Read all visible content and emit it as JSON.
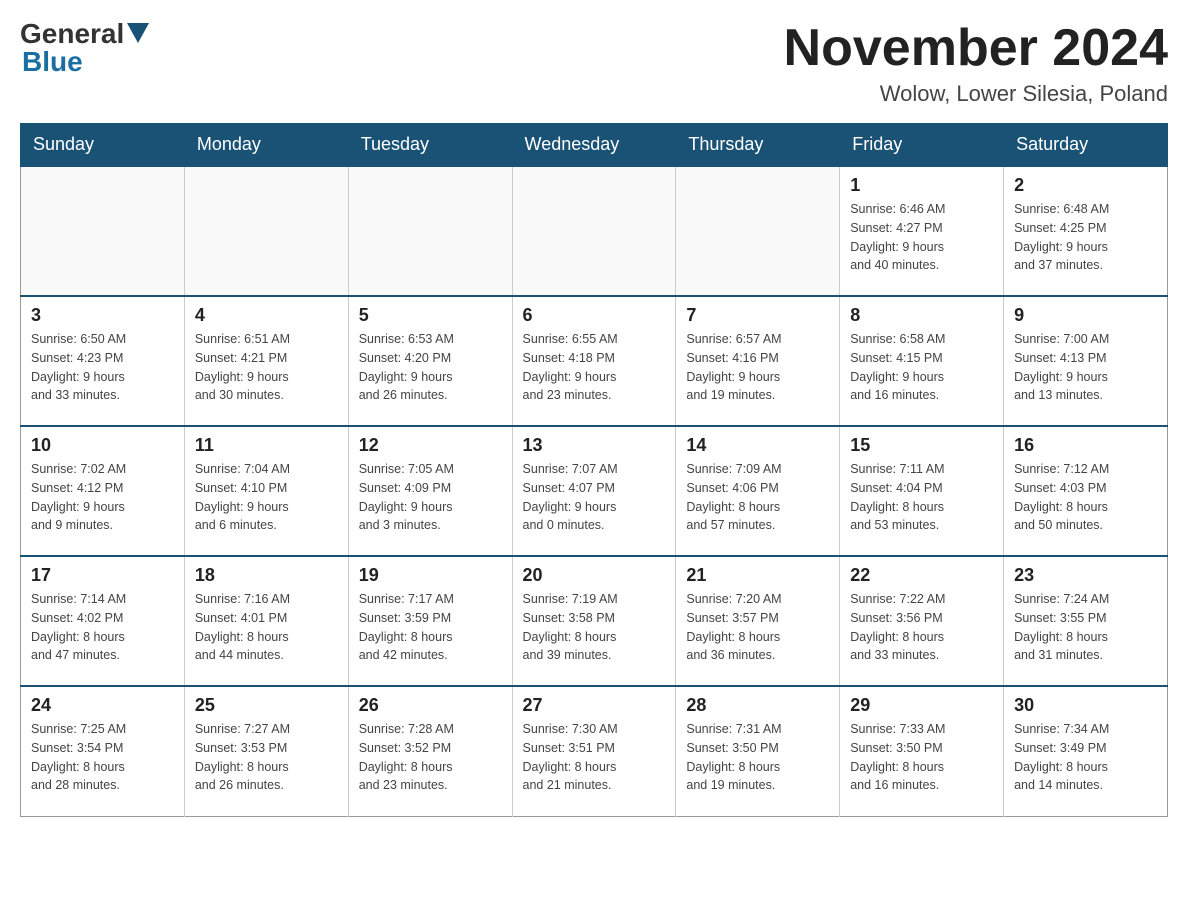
{
  "header": {
    "logo_general": "General",
    "logo_blue": "Blue",
    "title": "November 2024",
    "subtitle": "Wolow, Lower Silesia, Poland"
  },
  "days_of_week": [
    "Sunday",
    "Monday",
    "Tuesday",
    "Wednesday",
    "Thursday",
    "Friday",
    "Saturday"
  ],
  "weeks": [
    [
      {
        "day": "",
        "info": ""
      },
      {
        "day": "",
        "info": ""
      },
      {
        "day": "",
        "info": ""
      },
      {
        "day": "",
        "info": ""
      },
      {
        "day": "",
        "info": ""
      },
      {
        "day": "1",
        "info": "Sunrise: 6:46 AM\nSunset: 4:27 PM\nDaylight: 9 hours\nand 40 minutes."
      },
      {
        "day": "2",
        "info": "Sunrise: 6:48 AM\nSunset: 4:25 PM\nDaylight: 9 hours\nand 37 minutes."
      }
    ],
    [
      {
        "day": "3",
        "info": "Sunrise: 6:50 AM\nSunset: 4:23 PM\nDaylight: 9 hours\nand 33 minutes."
      },
      {
        "day": "4",
        "info": "Sunrise: 6:51 AM\nSunset: 4:21 PM\nDaylight: 9 hours\nand 30 minutes."
      },
      {
        "day": "5",
        "info": "Sunrise: 6:53 AM\nSunset: 4:20 PM\nDaylight: 9 hours\nand 26 minutes."
      },
      {
        "day": "6",
        "info": "Sunrise: 6:55 AM\nSunset: 4:18 PM\nDaylight: 9 hours\nand 23 minutes."
      },
      {
        "day": "7",
        "info": "Sunrise: 6:57 AM\nSunset: 4:16 PM\nDaylight: 9 hours\nand 19 minutes."
      },
      {
        "day": "8",
        "info": "Sunrise: 6:58 AM\nSunset: 4:15 PM\nDaylight: 9 hours\nand 16 minutes."
      },
      {
        "day": "9",
        "info": "Sunrise: 7:00 AM\nSunset: 4:13 PM\nDaylight: 9 hours\nand 13 minutes."
      }
    ],
    [
      {
        "day": "10",
        "info": "Sunrise: 7:02 AM\nSunset: 4:12 PM\nDaylight: 9 hours\nand 9 minutes."
      },
      {
        "day": "11",
        "info": "Sunrise: 7:04 AM\nSunset: 4:10 PM\nDaylight: 9 hours\nand 6 minutes."
      },
      {
        "day": "12",
        "info": "Sunrise: 7:05 AM\nSunset: 4:09 PM\nDaylight: 9 hours\nand 3 minutes."
      },
      {
        "day": "13",
        "info": "Sunrise: 7:07 AM\nSunset: 4:07 PM\nDaylight: 9 hours\nand 0 minutes."
      },
      {
        "day": "14",
        "info": "Sunrise: 7:09 AM\nSunset: 4:06 PM\nDaylight: 8 hours\nand 57 minutes."
      },
      {
        "day": "15",
        "info": "Sunrise: 7:11 AM\nSunset: 4:04 PM\nDaylight: 8 hours\nand 53 minutes."
      },
      {
        "day": "16",
        "info": "Sunrise: 7:12 AM\nSunset: 4:03 PM\nDaylight: 8 hours\nand 50 minutes."
      }
    ],
    [
      {
        "day": "17",
        "info": "Sunrise: 7:14 AM\nSunset: 4:02 PM\nDaylight: 8 hours\nand 47 minutes."
      },
      {
        "day": "18",
        "info": "Sunrise: 7:16 AM\nSunset: 4:01 PM\nDaylight: 8 hours\nand 44 minutes."
      },
      {
        "day": "19",
        "info": "Sunrise: 7:17 AM\nSunset: 3:59 PM\nDaylight: 8 hours\nand 42 minutes."
      },
      {
        "day": "20",
        "info": "Sunrise: 7:19 AM\nSunset: 3:58 PM\nDaylight: 8 hours\nand 39 minutes."
      },
      {
        "day": "21",
        "info": "Sunrise: 7:20 AM\nSunset: 3:57 PM\nDaylight: 8 hours\nand 36 minutes."
      },
      {
        "day": "22",
        "info": "Sunrise: 7:22 AM\nSunset: 3:56 PM\nDaylight: 8 hours\nand 33 minutes."
      },
      {
        "day": "23",
        "info": "Sunrise: 7:24 AM\nSunset: 3:55 PM\nDaylight: 8 hours\nand 31 minutes."
      }
    ],
    [
      {
        "day": "24",
        "info": "Sunrise: 7:25 AM\nSunset: 3:54 PM\nDaylight: 8 hours\nand 28 minutes."
      },
      {
        "day": "25",
        "info": "Sunrise: 7:27 AM\nSunset: 3:53 PM\nDaylight: 8 hours\nand 26 minutes."
      },
      {
        "day": "26",
        "info": "Sunrise: 7:28 AM\nSunset: 3:52 PM\nDaylight: 8 hours\nand 23 minutes."
      },
      {
        "day": "27",
        "info": "Sunrise: 7:30 AM\nSunset: 3:51 PM\nDaylight: 8 hours\nand 21 minutes."
      },
      {
        "day": "28",
        "info": "Sunrise: 7:31 AM\nSunset: 3:50 PM\nDaylight: 8 hours\nand 19 minutes."
      },
      {
        "day": "29",
        "info": "Sunrise: 7:33 AM\nSunset: 3:50 PM\nDaylight: 8 hours\nand 16 minutes."
      },
      {
        "day": "30",
        "info": "Sunrise: 7:34 AM\nSunset: 3:49 PM\nDaylight: 8 hours\nand 14 minutes."
      }
    ]
  ]
}
